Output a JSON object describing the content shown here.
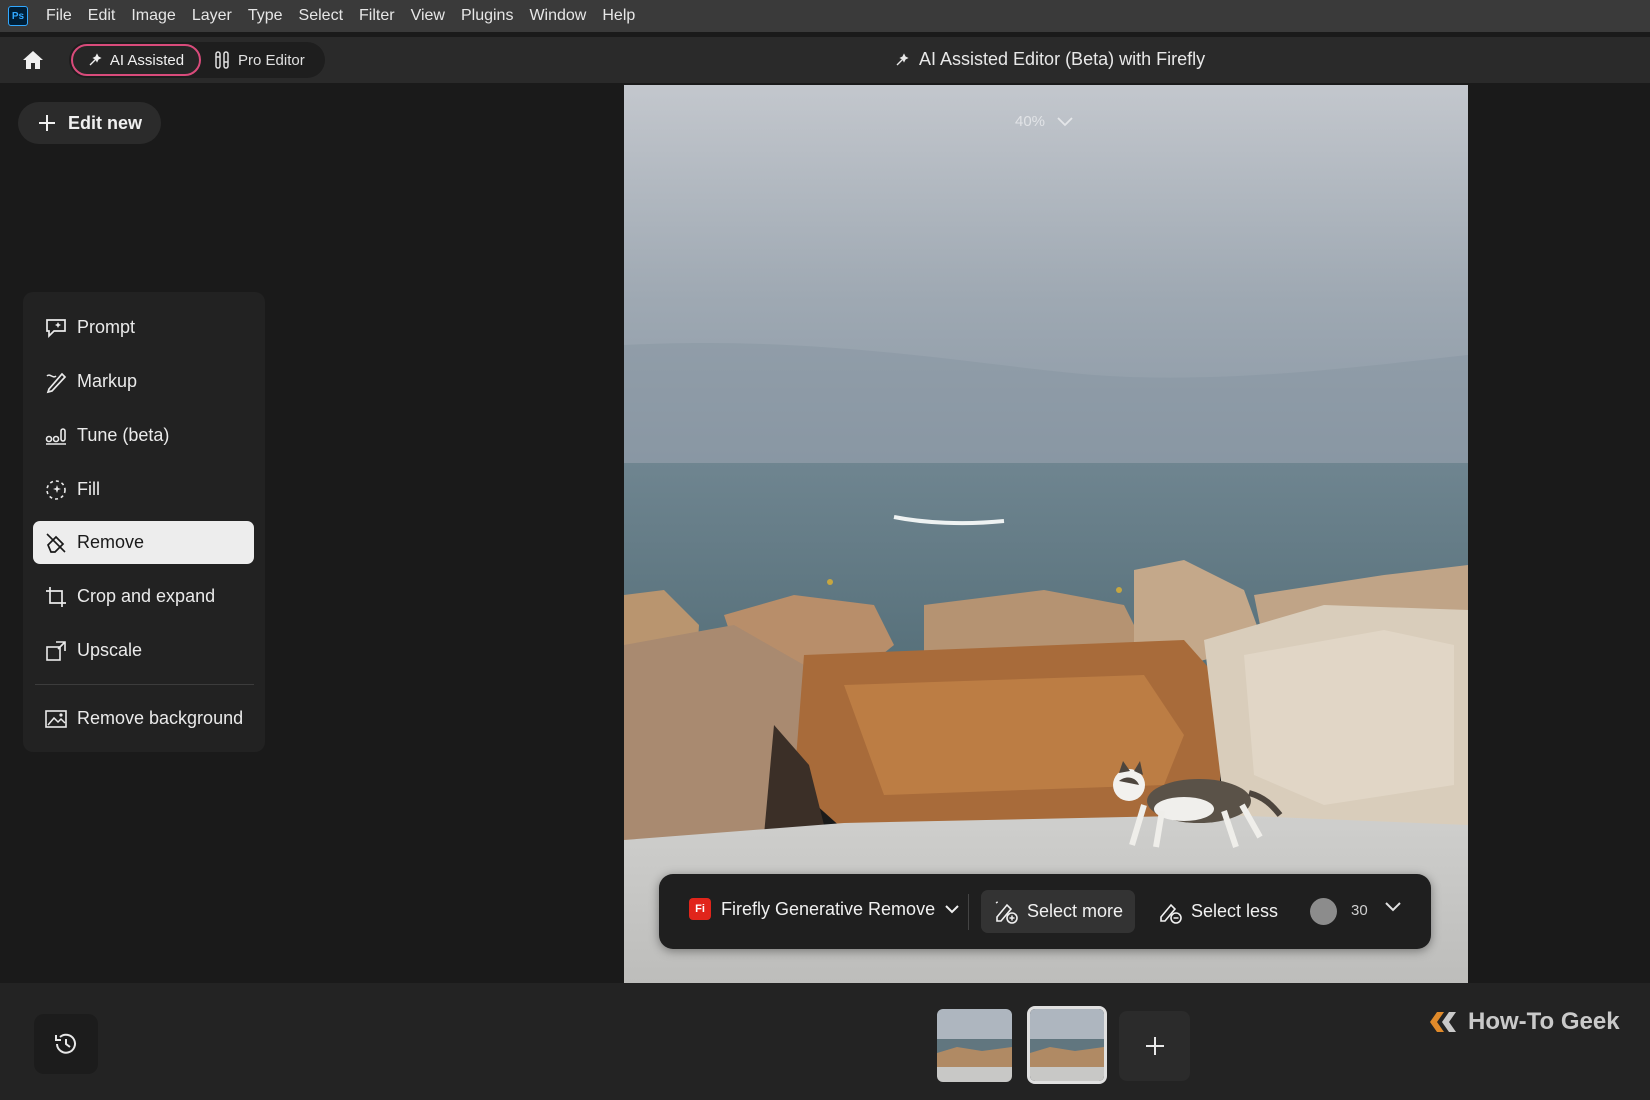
{
  "app": {
    "logo_text": "Ps",
    "menu": [
      "File",
      "Edit",
      "Image",
      "Layer",
      "Type",
      "Select",
      "Filter",
      "View",
      "Plugins",
      "Window",
      "Help"
    ]
  },
  "topbar": {
    "mode_ai_label": "AI Assisted",
    "mode_pro_label": "Pro Editor",
    "title": "AI Assisted Editor (Beta) with Firefly"
  },
  "sidebar": {
    "edit_new_label": "Edit new",
    "tools": [
      {
        "label": "Prompt",
        "icon": "prompt-icon"
      },
      {
        "label": "Markup",
        "icon": "markup-icon"
      },
      {
        "label": "Tune (beta)",
        "icon": "tune-icon"
      },
      {
        "label": "Fill",
        "icon": "fill-icon"
      },
      {
        "label": "Remove",
        "icon": "remove-icon",
        "active": true
      },
      {
        "label": "Crop and expand",
        "icon": "crop-icon"
      },
      {
        "label": "Upscale",
        "icon": "upscale-icon"
      },
      {
        "label": "Remove background",
        "icon": "remove-background-icon"
      }
    ]
  },
  "canvas": {
    "zoom": "40%"
  },
  "remove_bar": {
    "badge_text": "Fi",
    "model_label": "Firefly Generative Remove",
    "select_more_label": "Select more",
    "select_less_label": "Select less",
    "brush_size": "30"
  },
  "bottom": {
    "watermark": "How-To Geek"
  },
  "colors": {
    "accent_border": "#d94b7b",
    "firefly_red": "#e1251b",
    "active_tool_bg": "#ededed"
  }
}
